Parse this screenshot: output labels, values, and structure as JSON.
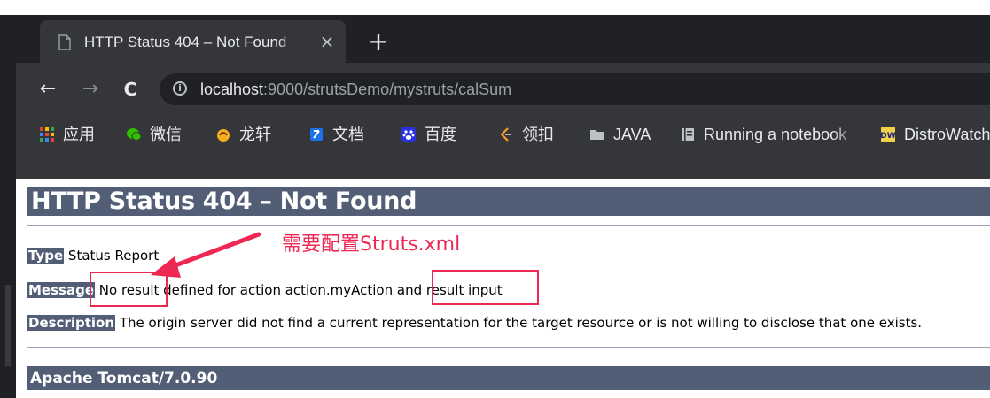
{
  "browser": {
    "tab": {
      "title": "HTTP Status 404 – Not Found",
      "close": "×"
    },
    "new_tab": "+",
    "nav": {
      "back": "←",
      "forward": "→",
      "reload": "C"
    },
    "address": {
      "host": "localhost",
      "rest": ":9000/strutsDemo/mystruts/calSum"
    },
    "bookmarks": [
      {
        "label": "应用",
        "icon": "apps-grid-icon"
      },
      {
        "label": "微信",
        "icon": "wechat-icon"
      },
      {
        "label": "龙轩",
        "icon": "longxuan-icon"
      },
      {
        "label": "文档",
        "icon": "docs-icon"
      },
      {
        "label": "百度",
        "icon": "baidu-icon"
      },
      {
        "label": "领扣",
        "icon": "leetcode-icon"
      },
      {
        "label": "JAVA",
        "icon": "folder-icon"
      },
      {
        "label": "Running a notebook",
        "icon": "notebook-icon"
      },
      {
        "label": "DistroWatch",
        "icon": "distrowatch-icon"
      }
    ]
  },
  "page": {
    "title": "HTTP Status 404 – Not Found",
    "type_label": "Type",
    "type_value": "Status Report",
    "message_label": "Message",
    "message_value_1": "No result",
    "message_value_2": " defined for action action.myAction and ",
    "message_value_3": "result input",
    "description_label": "Description",
    "description_value": "The origin server did not find a current representation for the target resource or is not willing to disclose that one exists.",
    "footer": "Apache Tomcat/7.0.90"
  },
  "annotation": {
    "note": "需要配置Struts.xml",
    "color": "#ee2753"
  },
  "colors": {
    "tomcat_header": "#525d76",
    "chrome_dark": "#202124",
    "chrome_toolbar": "#35363a"
  }
}
